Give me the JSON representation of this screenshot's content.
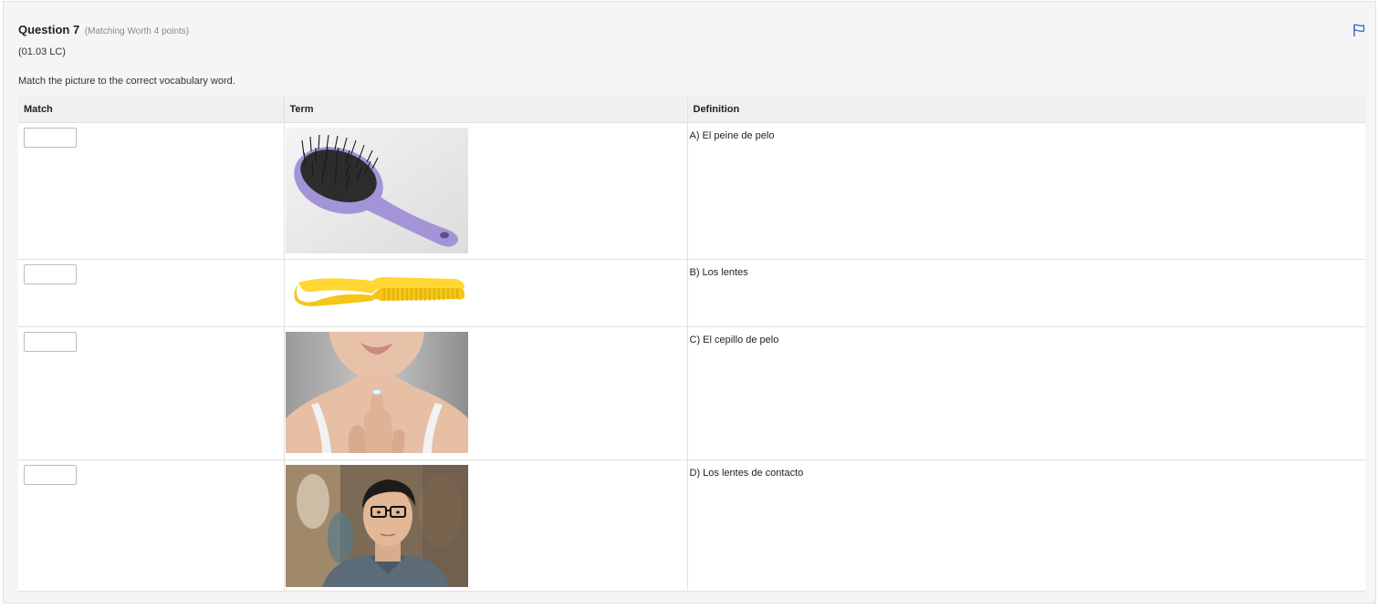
{
  "question": {
    "title": "Question 7",
    "meta": "(Matching Worth 4 points)",
    "code": "(01.03 LC)",
    "instructions": "Match the picture to the correct vocabulary word."
  },
  "icons": {
    "flag": "flag-icon"
  },
  "colors": {
    "accent": "#2a6ebb",
    "panel_bg": "#f5f5f5",
    "header_bg": "#f0f0f0"
  },
  "table": {
    "headers": [
      "Match",
      "Term",
      "Definition"
    ],
    "rows": [
      {
        "match_value": "",
        "term_image": "purple-hairbrush-image",
        "definition": "A) El peine de pelo"
      },
      {
        "match_value": "",
        "term_image": "yellow-comb-image",
        "definition": "B) Los lentes"
      },
      {
        "match_value": "",
        "term_image": "contact-lens-on-finger-image",
        "definition": "C) El cepillo de pelo"
      },
      {
        "match_value": "",
        "term_image": "man-wearing-glasses-image",
        "definition": "D) Los lentes de contacto"
      }
    ]
  }
}
